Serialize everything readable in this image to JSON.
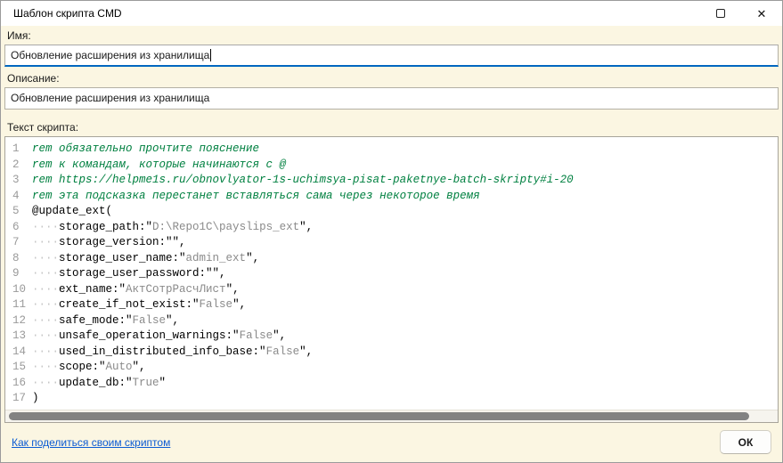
{
  "window": {
    "title": "Шаблон скрипта CMD",
    "maximize_icon": "maximize-square",
    "close_icon": "✕"
  },
  "form": {
    "name_label": "Имя:",
    "name_value": "Обновление расширения из хранилища",
    "description_label": "Описание:",
    "description_value": "Обновление расширения из хранилища",
    "script_label": "Текст скрипта:"
  },
  "editor": {
    "lines": [
      [
        {
          "t": "rem обязательно прочтите пояснение",
          "c": "comment"
        }
      ],
      [
        {
          "t": "rem к командам, которые начинаются с @",
          "c": "comment"
        }
      ],
      [
        {
          "t": "rem https://helpme1s.ru/obnovlyator-1s-uchimsya-pisat-paketnye-batch-skripty#i-20",
          "c": "comment"
        }
      ],
      [
        {
          "t": "rem эта подсказка перестанет вставляться сама через некоторое время",
          "c": "comment"
        }
      ],
      [
        {
          "t": "@update_ext(",
          "c": "plain"
        }
      ],
      [
        {
          "t": "····",
          "c": "ws"
        },
        {
          "t": "storage_path:\"",
          "c": "plain"
        },
        {
          "t": "D:\\Repo1C\\payslips_ext",
          "c": "string"
        },
        {
          "t": "\",",
          "c": "plain"
        }
      ],
      [
        {
          "t": "····",
          "c": "ws"
        },
        {
          "t": "storage_version:\"\",",
          "c": "plain"
        }
      ],
      [
        {
          "t": "····",
          "c": "ws"
        },
        {
          "t": "storage_user_name:\"",
          "c": "plain"
        },
        {
          "t": "admin_ext",
          "c": "string"
        },
        {
          "t": "\",",
          "c": "plain"
        }
      ],
      [
        {
          "t": "····",
          "c": "ws"
        },
        {
          "t": "storage_user_password:\"\",",
          "c": "plain"
        }
      ],
      [
        {
          "t": "····",
          "c": "ws"
        },
        {
          "t": "ext_name:\"",
          "c": "plain"
        },
        {
          "t": "АктСотрРасчЛист",
          "c": "string"
        },
        {
          "t": "\",",
          "c": "plain"
        }
      ],
      [
        {
          "t": "····",
          "c": "ws"
        },
        {
          "t": "create_if_not_exist:\"",
          "c": "plain"
        },
        {
          "t": "False",
          "c": "string"
        },
        {
          "t": "\",",
          "c": "plain"
        }
      ],
      [
        {
          "t": "····",
          "c": "ws"
        },
        {
          "t": "safe_mode:\"",
          "c": "plain"
        },
        {
          "t": "False",
          "c": "string"
        },
        {
          "t": "\",",
          "c": "plain"
        }
      ],
      [
        {
          "t": "····",
          "c": "ws"
        },
        {
          "t": "unsafe_operation_warnings:\"",
          "c": "plain"
        },
        {
          "t": "False",
          "c": "string"
        },
        {
          "t": "\",",
          "c": "plain"
        }
      ],
      [
        {
          "t": "····",
          "c": "ws"
        },
        {
          "t": "used_in_distributed_info_base:\"",
          "c": "plain"
        },
        {
          "t": "False",
          "c": "string"
        },
        {
          "t": "\",",
          "c": "plain"
        }
      ],
      [
        {
          "t": "····",
          "c": "ws"
        },
        {
          "t": "scope:\"",
          "c": "plain"
        },
        {
          "t": "Auto",
          "c": "string"
        },
        {
          "t": "\",",
          "c": "plain"
        }
      ],
      [
        {
          "t": "····",
          "c": "ws"
        },
        {
          "t": "update_db:\"",
          "c": "plain"
        },
        {
          "t": "True",
          "c": "string"
        },
        {
          "t": "\"",
          "c": "plain"
        }
      ],
      [
        {
          "t": ")",
          "c": "plain"
        }
      ]
    ]
  },
  "footer": {
    "share_link": "Как поделиться своим скриптом",
    "ok_label": "ОК"
  },
  "colors": {
    "accent": "#0067c0",
    "comment_green": "#008040",
    "string_gray": "#8a8a8a",
    "link_blue": "#0b5bd3",
    "window_bg": "#fbf6e2"
  }
}
